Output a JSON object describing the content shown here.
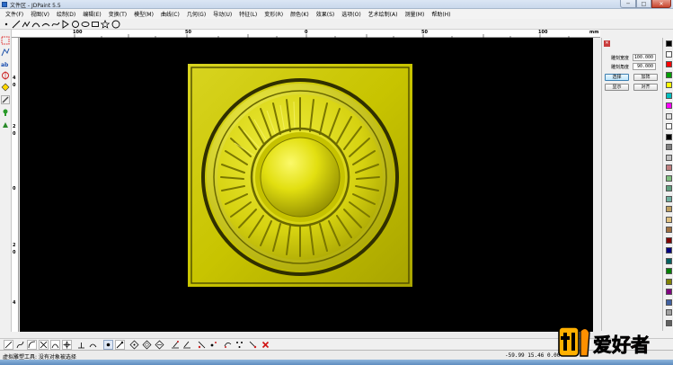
{
  "window": {
    "title": "文件区 - JDPaint 5.5",
    "min_label": "─",
    "max_label": "□",
    "close_label": "✕"
  },
  "menu": {
    "items": [
      "文件(F)",
      "视图(V)",
      "绘制(D)",
      "编辑(E)",
      "变换(T)",
      "模型(M)",
      "曲线(C)",
      "几何(G)",
      "导动(U)",
      "特征(L)",
      "变形(R)",
      "颜色(K)",
      "效果(S)",
      "选项(O)",
      "艺术绘制(A)",
      "测量(M)",
      "帮助(H)"
    ]
  },
  "ruler": {
    "unit": "mm",
    "labels": [
      "100",
      "50",
      "0",
      "50",
      "100"
    ],
    "v_labels": [
      "4",
      "0",
      "2",
      "0",
      "0",
      "2",
      "0",
      "4"
    ]
  },
  "panel": {
    "field1_label": "雕刻宽度",
    "field1_value": "100.000",
    "field2_label": "雕刻角度",
    "field2_value": "90.000",
    "btn_select": "选择",
    "btn_add": "加阵",
    "btn_show": "显示",
    "btn_align": "对齐"
  },
  "palette": {
    "colors": [
      "#000000",
      "#ffffff",
      "#ff0000",
      "#00a000",
      "#ffff00",
      "#00c0c0",
      "#ff00ff",
      "#e0e0e0",
      "#ffffff",
      "#000000",
      "#808080",
      "#c0c0c0",
      "#c08080",
      "#80c080",
      "#60a080",
      "#70b0a0",
      "#c0a060",
      "#e0c080",
      "#a07040",
      "#800000",
      "#000080",
      "#006060",
      "#008000",
      "#808000",
      "#800080",
      "#4060a0",
      "#a0a0a0",
      "#606060"
    ]
  },
  "status": {
    "message": "虚拟雕塑工具: 没有对象被选择",
    "coords": "-59.99 15.46 0.00"
  },
  "watermark": {
    "text": "爱好者"
  },
  "colors": {
    "relief_base": "#c8c400",
    "relief_highlight": "#f4f230",
    "relief_shadow": "#4a4800",
    "canvas_bg": "#000000"
  }
}
